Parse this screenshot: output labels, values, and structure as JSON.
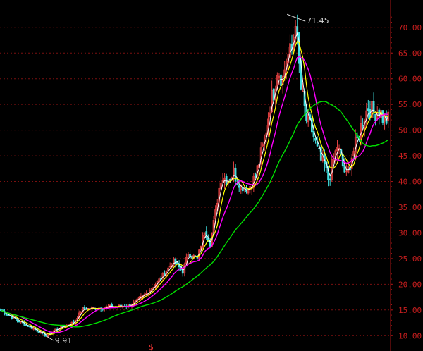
{
  "chart_data": {
    "type": "candlestick",
    "title": "",
    "xlabel": "",
    "ylabel": "",
    "ylim": [
      8.8,
      74.5
    ],
    "y_ticks": [
      "10.00",
      "15.00",
      "20.00",
      "25.00",
      "30.00",
      "35.00",
      "40.00",
      "45.00",
      "50.00",
      "55.00",
      "60.00",
      "65.00",
      "70.00"
    ],
    "grid": true,
    "colors": {
      "up": "#e04040",
      "down": "#40e0e0",
      "ma_short": "#ffffff",
      "ma_mid": "#ffff00",
      "ma_long": "#ff00ff",
      "ma_longest": "#00e000",
      "grid": "#7a1010",
      "axis": "#a01414"
    },
    "close_path": [
      [
        0,
        14.9
      ],
      [
        10,
        12.8
      ],
      [
        20,
        11.0
      ],
      [
        25,
        9.91
      ],
      [
        30,
        11.2
      ],
      [
        40,
        12.6
      ],
      [
        45,
        15.2
      ],
      [
        50,
        15.3
      ],
      [
        60,
        15.6
      ],
      [
        70,
        15.8
      ],
      [
        75,
        16.8
      ],
      [
        80,
        18.2
      ],
      [
        88,
        21.2
      ],
      [
        95,
        24.5
      ],
      [
        100,
        22.5
      ],
      [
        103,
        26.0
      ],
      [
        108,
        25.0
      ],
      [
        112,
        30.5
      ],
      [
        115,
        28.0
      ],
      [
        118,
        34.0
      ],
      [
        121,
        41.0
      ],
      [
        125,
        40.5
      ],
      [
        128,
        41.8
      ],
      [
        132,
        39.0
      ],
      [
        136,
        38.6
      ],
      [
        140,
        41.0
      ],
      [
        145,
        48.0
      ],
      [
        148,
        55.0
      ],
      [
        150,
        57.5
      ],
      [
        152,
        62.0
      ],
      [
        155,
        60.0
      ],
      [
        157,
        64.0
      ],
      [
        160,
        65.5
      ],
      [
        162,
        71.45
      ],
      [
        163,
        66.5
      ],
      [
        165,
        58.0
      ],
      [
        168,
        52.0
      ],
      [
        171,
        50.0
      ],
      [
        174,
        46.0
      ],
      [
        176,
        44.0
      ],
      [
        178,
        43.0
      ],
      [
        180,
        40.5
      ],
      [
        183,
        44.0
      ],
      [
        185,
        47.0
      ],
      [
        188,
        43.0
      ],
      [
        190,
        41.0
      ],
      [
        193,
        45.0
      ],
      [
        196,
        48.0
      ],
      [
        199,
        52.0
      ],
      [
        202,
        54.5
      ],
      [
        205,
        53.5
      ],
      [
        208,
        54.0
      ],
      [
        210,
        52.5
      ],
      [
        212,
        52.0
      ]
    ],
    "series": [
      {
        "key": "ma_short",
        "values": []
      },
      {
        "key": "ma_mid",
        "values": []
      },
      {
        "key": "ma_long",
        "values": []
      },
      {
        "key": "ma_longest",
        "values": []
      }
    ],
    "annotations": [
      {
        "text": "71.45",
        "kind": "high",
        "x": 162,
        "y": 71.45
      },
      {
        "text": "9.91",
        "kind": "low",
        "x": 25,
        "y": 9.91
      }
    ],
    "bottom_marker": "$"
  }
}
